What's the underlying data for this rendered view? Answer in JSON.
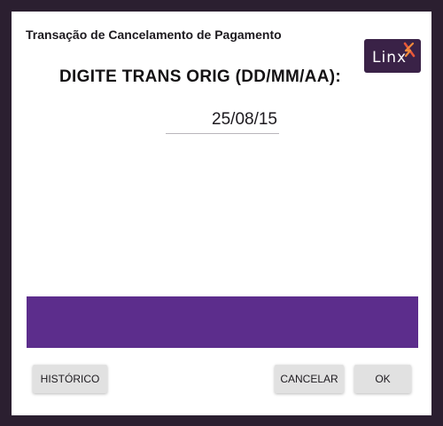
{
  "dialog": {
    "title": "Transação de Cancelamento de Pagamento",
    "prompt": "DIGITE TRANS ORIG (DD/MM/AA):",
    "date_value": "25/08/15"
  },
  "logo": {
    "text": "Linx",
    "brand_color": "#3a2247",
    "accent_color": "#e8563a"
  },
  "status_bar": {
    "color": "#5c2d8c"
  },
  "buttons": {
    "historico": "HISTÓRICO",
    "cancelar": "CANCELAR",
    "ok": "OK"
  }
}
